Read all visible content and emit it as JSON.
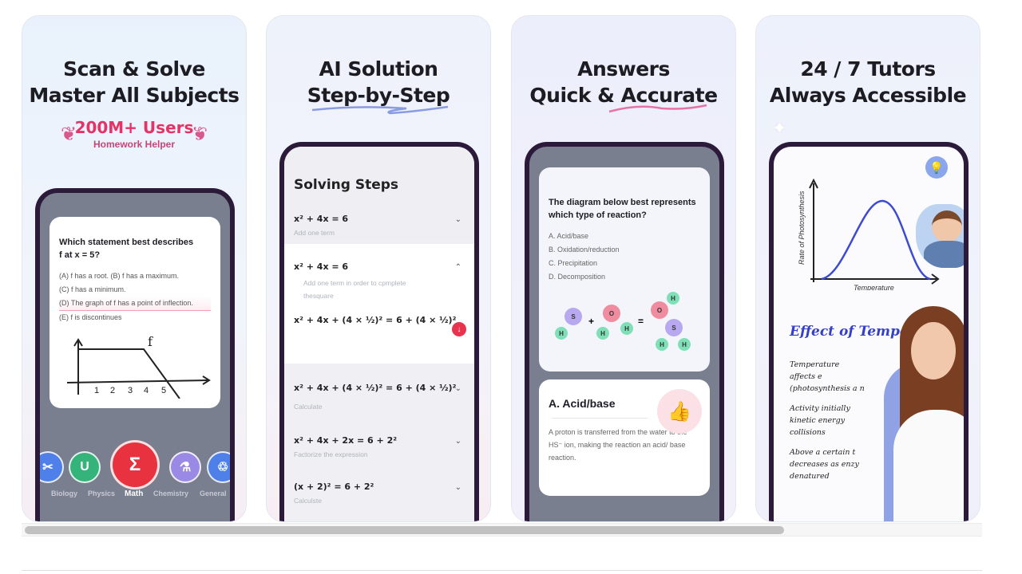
{
  "screenshots": [
    {
      "headline": [
        "Scan & Solve",
        "Master All Subjects"
      ],
      "badge": {
        "title": "200M+ Users",
        "subtitle": "Homework Helper"
      },
      "question": {
        "title": [
          "Which statement best describes",
          "f at x = 5?"
        ],
        "options": [
          "(A) f has a root.   (B) f has a maximum.",
          "(C)  f has a minimum.",
          "(D) The graph of f has a point of inflection.",
          "(E) f is discontinues"
        ],
        "graph_label": "f",
        "graph_ticks": [
          "1",
          "2",
          "3",
          "4",
          "5"
        ]
      },
      "subjects": [
        {
          "label": "Biology",
          "icon": "dna-icon",
          "glyph": "✂",
          "color": "#4f7fe8"
        },
        {
          "label": "Physics",
          "icon": "magnet-icon",
          "glyph": "U",
          "color": "#34b37a"
        },
        {
          "label": "Math",
          "icon": "sigma-icon",
          "glyph": "Σ",
          "color": "#e8323f",
          "active": true
        },
        {
          "label": "Chemistry",
          "icon": "flask-icon",
          "glyph": "⚗",
          "color": "#9a8ae6"
        },
        {
          "label": "General",
          "icon": "cluster-icon",
          "glyph": "♲",
          "color": "#4f7fe8"
        }
      ]
    },
    {
      "headline": [
        "AI Solution",
        "Step-by-Step"
      ],
      "steps_title": "Solving Steps",
      "steps": [
        {
          "eq": "x² + 4x = 6",
          "note": "Add one term",
          "state": "collapsed"
        },
        {
          "eq": "x² + 4x = 6",
          "note": "Add one term in order to cpmplete thesquare",
          "result": "x² + 4x + (4 × ½)² = 6 + (4 × ½)²",
          "state": "expanded"
        },
        {
          "eq": "x² + 4x + (4 × ½)² = 6 + (4 × ½)²",
          "note": "Calculate",
          "state": "collapsed"
        },
        {
          "eq": "x² + 4x + 2x = 6 + 2²",
          "note": "Factorize the expression",
          "state": "collapsed"
        },
        {
          "eq": "(x + 2)² = 6 + 2²",
          "note": "Calculste",
          "state": "collapsed"
        }
      ]
    },
    {
      "headline": [
        "Answers",
        "Quick & Accurate"
      ],
      "question": {
        "title": [
          "The diagram below best represents",
          "which type of reaction?"
        ],
        "options": [
          "A. Acid/base",
          "B. Oxidation/reduction",
          "C. Precipitation",
          "D. Decomposition"
        ]
      },
      "answer": {
        "title": "A. Acid/base",
        "text": "A proton is transferred from the water to the HS⁻ ion, making the reaction an acid/ base reaction."
      }
    },
    {
      "headline": [
        "24 / 7 Tutors",
        "Always Accessible"
      ],
      "graph": {
        "ylabel": "Rate of Photosynthesis",
        "xlabel": "Temperature"
      },
      "note_title": "Effect of Temperatu",
      "notes": [
        "Temperature affects e (photosynthesis a n",
        "Activity initially kinetic energy collisions",
        "Above a certain t decreases as enzy denatured"
      ]
    }
  ],
  "scrollbar": {
    "position_fraction": 0.0,
    "visible_fraction": 0.79
  }
}
